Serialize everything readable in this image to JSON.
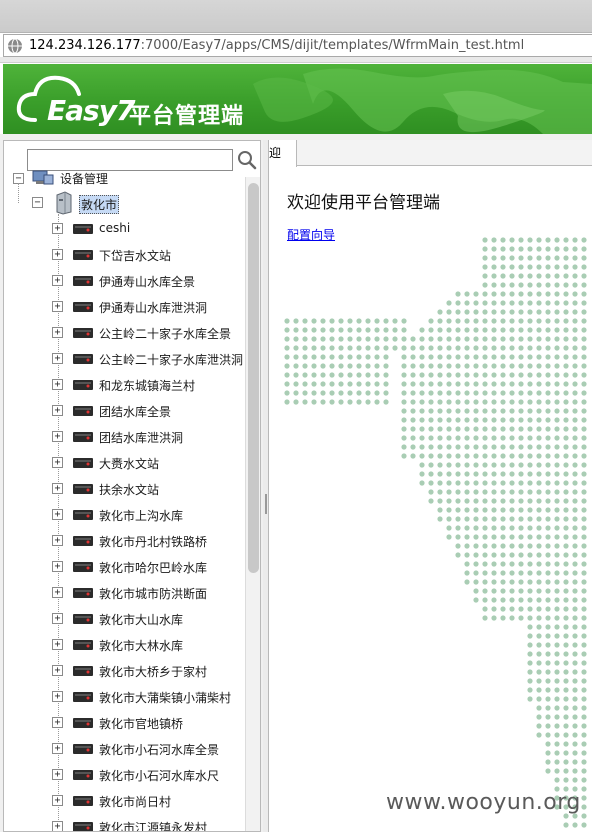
{
  "browser": {
    "url_host": "124.234.126.177",
    "url_path": ":7000/Easy7/apps/CMS/dijit/templates/WfrmMain_test.html"
  },
  "banner": {
    "logo_text": "Easy7",
    "title": "平台管理端"
  },
  "left_panel": {
    "search_placeholder": "",
    "tree": {
      "root_label": "设备管理",
      "city_label": "敦化市",
      "devices": [
        "ceshi",
        "下岱吉水文站",
        "伊通寿山水库全景",
        "伊通寿山水库泄洪洞",
        "公主岭二十家子水库全景",
        "公主岭二十家子水库泄洪洞",
        "和龙东城镇海兰村",
        "团结水库全景",
        "团结水库泄洪洞",
        "大赉水文站",
        "扶余水文站",
        "敦化市上沟水库",
        "敦化市丹北村铁路桥",
        "敦化市哈尔巴岭水库",
        "敦化市城市防洪断面",
        "敦化市大山水库",
        "敦化市大林水库",
        "敦化市大桥乡于家村",
        "敦化市大蒲柴镇小蒲柴村",
        "敦化市官地镇桥",
        "敦化市小石河水库全景",
        "敦化市小石河水库水尺",
        "敦化市尚日村",
        "敦化市江源镇永发村"
      ]
    }
  },
  "right_panel": {
    "tab_label": "欢迎",
    "welcome_text": "欢迎使用平台管理端",
    "config_link": "配置向导"
  },
  "watermark": "www.wooyun.org",
  "colors": {
    "banner_green": "#3a9e2a",
    "selection_bg": "#c6daf5",
    "link_blue": "#0000ee",
    "map_dots": "#a9cdb4"
  }
}
